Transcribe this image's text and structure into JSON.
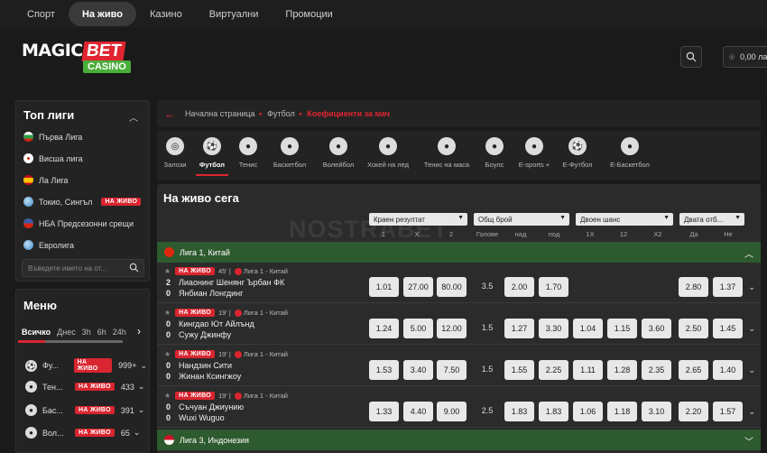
{
  "topnav": [
    "Спорт",
    "На живо",
    "Казино",
    "Виртуални",
    "Промоции"
  ],
  "logo": {
    "magic": "MAGIC",
    "bet": "BET",
    "casino": "CASINO"
  },
  "balance": "0,00 ла",
  "top_leagues": {
    "title": "Топ лиги",
    "items": [
      {
        "label": "Първа Лига",
        "flag": "#2a9d43",
        "live": ""
      },
      {
        "label": "Висша лига",
        "flag": "#ffffff",
        "live": ""
      },
      {
        "label": "Ла Лига",
        "flag": "#e8a81a",
        "live": ""
      },
      {
        "label": "Токио, Сингъл",
        "flag": "#6aa4d9",
        "live": "НА ЖИВО"
      },
      {
        "label": "НБА Предсезонни срещи",
        "flag": "#6b8fd1",
        "live": ""
      },
      {
        "label": "Евролига",
        "flag": "#4c8bd6",
        "live": ""
      }
    ],
    "search_placeholder": "Въведете името на от..."
  },
  "menu": {
    "title": "Меню",
    "tabs": [
      "Всичко",
      "Днес",
      "3h",
      "6h",
      "24h"
    ],
    "sports": [
      {
        "name": "Фу...",
        "live": "НА ЖИВО",
        "count": "999+",
        "icon": "⚽"
      },
      {
        "name": "Тен...",
        "live": "НА ЖИВО",
        "count": "433",
        "icon": "●"
      },
      {
        "name": "Бас...",
        "live": "НА ЖИВО",
        "count": "391",
        "icon": "●"
      },
      {
        "name": "Вол...",
        "live": "НА ЖИВО",
        "count": "65",
        "icon": "●"
      }
    ]
  },
  "breadcrumb": {
    "home": "Начална страница",
    "sport": "Футбол",
    "current": "Коефициенти за мач"
  },
  "sport_tabs": [
    {
      "label": "Залози",
      "icon": "◎"
    },
    {
      "label": "Футбол",
      "icon": "⚽"
    },
    {
      "label": "Тенис",
      "icon": "●"
    },
    {
      "label": "Баскетбол",
      "icon": "●"
    },
    {
      "label": "Волейбол",
      "icon": "●"
    },
    {
      "label": "Хокей на лед",
      "icon": "●"
    },
    {
      "label": "Тенис на маса",
      "icon": "●"
    },
    {
      "label": "Боулс",
      "icon": "●"
    },
    {
      "label": "E-sports +",
      "icon": "●"
    },
    {
      "label": "E-Футбол",
      "icon": "⚽"
    },
    {
      "label": "E-Баскетбол",
      "icon": "●"
    }
  ],
  "live_now": {
    "title": "На живо сега",
    "markets": [
      "Краен резултат",
      "Общ брой",
      "Двоен шанс",
      "Двата отб..."
    ],
    "columns": [
      "1",
      "X",
      "2",
      "Голове",
      "над",
      "под",
      "1X",
      "12",
      "X2",
      "Да",
      "Не"
    ]
  },
  "league1": {
    "name": "Лига 1, Китай"
  },
  "league2": {
    "name": "Лига 3, Индонезия"
  },
  "matches": [
    {
      "minute": "45'",
      "league": "Лига 1 - Китай",
      "home": "Лиаонинг Шенянг Ърбан ФК",
      "away": "Янбиан Лонгдинг",
      "home_score": "2",
      "away_score": "0",
      "odds": [
        "1.01",
        "27.00",
        "80.00",
        "3.5",
        "2.00",
        "1.70",
        "",
        "",
        "",
        "2.80",
        "1.37"
      ]
    },
    {
      "minute": "19'",
      "league": "Лига 1 - Китай",
      "home": "Кингдао Ют Айлънд",
      "away": "Сужу Джинфу",
      "home_score": "0",
      "away_score": "0",
      "odds": [
        "1.24",
        "5.00",
        "12.00",
        "1.5",
        "1.27",
        "3.30",
        "1.04",
        "1.15",
        "3.60",
        "2.50",
        "1.45"
      ]
    },
    {
      "minute": "19'",
      "league": "Лига 1 - Китай",
      "home": "Нандзин Сити",
      "away": "Жинан Ксингжоу",
      "home_score": "0",
      "away_score": "0",
      "odds": [
        "1.53",
        "3.40",
        "7.50",
        "1.5",
        "1.55",
        "2.25",
        "1.11",
        "1.28",
        "2.35",
        "2.65",
        "1.40"
      ]
    },
    {
      "minute": "19'",
      "league": "Лига 1 - Китай",
      "home": "Съчуан Джиунию",
      "away": "Wuxi Wuguo",
      "home_score": "0",
      "away_score": "0",
      "odds": [
        "1.33",
        "4.40",
        "9.00",
        "2.5",
        "1.83",
        "1.83",
        "1.06",
        "1.18",
        "3.10",
        "2.20",
        "1.57"
      ]
    }
  ],
  "live_label": "НА ЖИВО",
  "watermark": "NOSTRABET"
}
